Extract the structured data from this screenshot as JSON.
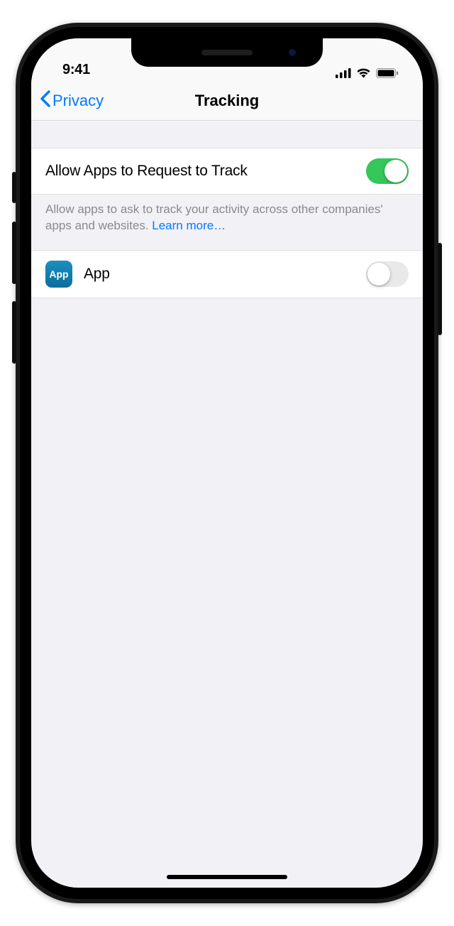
{
  "status": {
    "time": "9:41"
  },
  "nav": {
    "back_label": "Privacy",
    "title": "Tracking"
  },
  "rows": {
    "allow_tracking": {
      "label": "Allow Apps to Request to Track",
      "enabled": true
    },
    "app_item": {
      "icon_text": "App",
      "label": "App",
      "enabled": false
    }
  },
  "footer": {
    "text": "Allow apps to ask to track your activity across other companies' apps and websites. ",
    "link": "Learn more…"
  }
}
